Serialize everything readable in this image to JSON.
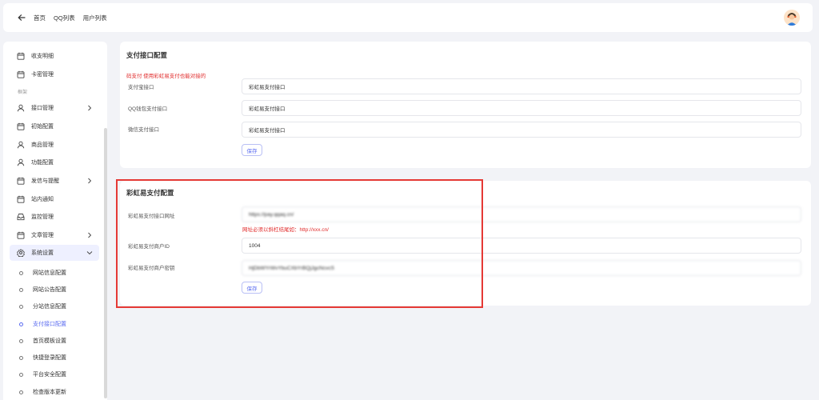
{
  "topbar": {
    "breadcrumbs": [
      "首页",
      "QQ列表",
      "用户列表"
    ]
  },
  "sidebar": {
    "items_top": [
      {
        "label": "收支明细",
        "icon": "calendar-icon"
      },
      {
        "label": "卡密管理",
        "icon": "calendar-icon"
      }
    ],
    "section_label": "框架",
    "items": [
      {
        "label": "接口管理",
        "icon": "user-icon",
        "has_children": true
      },
      {
        "label": "初始配置",
        "icon": "calendar-icon"
      },
      {
        "label": "商品管理",
        "icon": "user-icon"
      },
      {
        "label": "功能配置",
        "icon": "user-icon"
      },
      {
        "label": "发信与提醒",
        "icon": "calendar-icon",
        "has_children": true
      },
      {
        "label": "站内通知",
        "icon": "calendar-icon"
      },
      {
        "label": "监控管理",
        "icon": "inbox-icon"
      },
      {
        "label": "文章管理",
        "icon": "calendar-icon",
        "has_children": true
      },
      {
        "label": "系统设置",
        "icon": "gear-icon",
        "expanded": true
      }
    ],
    "sub_items": [
      {
        "label": "网站信息配置"
      },
      {
        "label": "网站公告配置"
      },
      {
        "label": "分站信息配置"
      },
      {
        "label": "支付接口配置",
        "current": true
      },
      {
        "label": "首页模板设置"
      },
      {
        "label": "快捷登录配置"
      },
      {
        "label": "平台安全配置"
      },
      {
        "label": "检查版本更新"
      }
    ]
  },
  "payment_card": {
    "title": "支付接口配置",
    "note": "码支付 使用彩虹易支付也能对接的",
    "rows": [
      {
        "label": "支付宝接口",
        "value": "彩虹易支付接口"
      },
      {
        "label": "QQ钱包支付接口",
        "value": "彩虹易支付接口"
      },
      {
        "label": "微信支付接口",
        "value": "彩虹易支付接口"
      }
    ],
    "save_label": "保存"
  },
  "rainbow_card": {
    "title": "彩虹易支付配置",
    "url_label": "彩虹易支付接口网址",
    "url_value": "https://pay.qqaq.cn/",
    "url_hint": "网址必须以斜杠结尾如：http://xxx.cn/",
    "merchant_id_label": "彩虹易支付商户ID",
    "merchant_id_value": "1004",
    "merchant_key_label": "彩虹易支付商户密钥",
    "merchant_key_value": "HjDbWYrWvYbuCXbYrBQjJgcNcvcS",
    "save_label": "保存"
  },
  "colors": {
    "accent": "#5b6cf0",
    "highlight_border": "#e53935",
    "warning_text": "#e02a2a"
  }
}
